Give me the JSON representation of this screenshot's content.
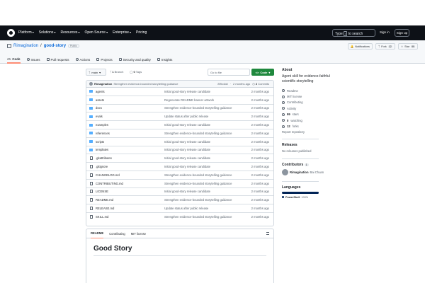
{
  "header": {
    "nav": [
      "Platform",
      "Solutions",
      "Resources",
      "Open Source",
      "Enterprise",
      "Pricing"
    ],
    "nav_caret": [
      true,
      true,
      true,
      true,
      true,
      false
    ],
    "search_label": "Type",
    "search_key": "/",
    "search_suffix": "to search",
    "signin": "Sign in",
    "signup": "Sign up"
  },
  "repo": {
    "owner": "Rimagination",
    "separator": "/",
    "name": "good-story",
    "visibility": "Public",
    "notifications": "Notifications",
    "fork": "Fork",
    "fork_count": "12",
    "star": "Star",
    "star_count": "99"
  },
  "tabs": [
    "Code",
    "Issues",
    "Pull requests",
    "Actions",
    "Projects",
    "Security and quality",
    "Insights"
  ],
  "branchbar": {
    "branch": "main",
    "branch_count": "1",
    "branch_label": "Branch",
    "tag_count": "0",
    "tag_label": "Tags",
    "goto": "Go to file",
    "code": "Code"
  },
  "commit": {
    "author": "Rimagination",
    "message": "Strengthen evidence-bounded storytelling guidance",
    "hash": "8f9c4dd",
    "time": "2 months ago",
    "count": "2",
    "count_label": "Commits"
  },
  "files": [
    {
      "name": "agents",
      "type": "folder",
      "message": "Initial good-story release candidate",
      "date": "2 months ago"
    },
    {
      "name": "assets",
      "type": "folder",
      "message": "Regenerate README banner artwork",
      "date": "2 months ago"
    },
    {
      "name": "docs",
      "type": "folder",
      "message": "Strengthen evidence-bounded storytelling guidance",
      "date": "2 months ago"
    },
    {
      "name": "evals",
      "type": "folder",
      "message": "Update status after public release",
      "date": "2 months ago"
    },
    {
      "name": "examples",
      "type": "folder",
      "message": "Initial good-story release candidate",
      "date": "2 months ago"
    },
    {
      "name": "references",
      "type": "folder",
      "message": "Strengthen evidence-bounded storytelling guidance",
      "date": "2 months ago"
    },
    {
      "name": "scripts",
      "type": "folder",
      "message": "Initial good-story release candidate",
      "date": "2 months ago"
    },
    {
      "name": "templates",
      "type": "folder",
      "message": "Initial good-story release candidate",
      "date": "2 months ago"
    },
    {
      "name": ".gitattributes",
      "type": "file",
      "message": "Initial good-story release candidate",
      "date": "2 months ago"
    },
    {
      "name": ".gitignore",
      "type": "file",
      "message": "Initial good-story release candidate",
      "date": "2 months ago"
    },
    {
      "name": "CHANGELOG.md",
      "type": "file",
      "message": "Strengthen evidence-bounded storytelling guidance",
      "date": "2 months ago"
    },
    {
      "name": "CONTRIBUTING.md",
      "type": "file",
      "message": "Strengthen evidence-bounded storytelling guidance",
      "date": "2 months ago"
    },
    {
      "name": "LICENSE",
      "type": "file",
      "message": "Initial good-story release candidate",
      "date": "2 months ago"
    },
    {
      "name": "README.md",
      "type": "file",
      "message": "Strengthen evidence-bounded storytelling guidance",
      "date": "2 months ago"
    },
    {
      "name": "RELEASE.md",
      "type": "file",
      "message": "Update status after public release",
      "date": "2 months ago"
    },
    {
      "name": "SKILL.md",
      "type": "file",
      "message": "Strengthen evidence-bounded storytelling guidance",
      "date": "2 months ago"
    }
  ],
  "readme": {
    "tabs": [
      "README",
      "Contributing",
      "MIT license"
    ],
    "heading": "Good Story"
  },
  "about": {
    "title": "About",
    "description": "Agent skill for evidence-faithful scientific storytelling",
    "readme": "Readme",
    "license": "MIT license",
    "contributing": "Contributing",
    "activity": "Activity",
    "stars_count": "99",
    "stars_label": "stars",
    "watching_count": "0",
    "watching_label": "watching",
    "forks_count": "12",
    "forks_label": "forks",
    "report": "Report repository"
  },
  "releases": {
    "title": "Releases",
    "text": "No releases published"
  },
  "contributors": {
    "title": "Contributors",
    "count": "1",
    "name": "Rimagination",
    "fullname": "Bai Chuan"
  },
  "languages": {
    "title": "Languages",
    "name": "PowerShell",
    "percent": "100%",
    "color": "#012456"
  },
  "colors": {
    "accent": "#1f883d",
    "link": "#0969da",
    "header_bg": "#0d1117",
    "folder": "#54aeff",
    "tab_underline": "#fd8c73"
  }
}
